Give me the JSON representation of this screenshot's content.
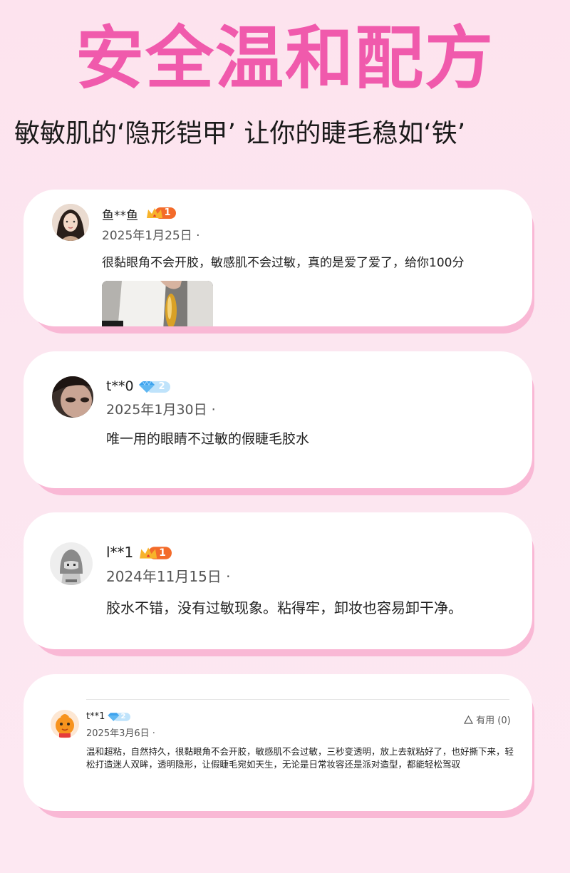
{
  "page": {
    "headline": "安全温和配方",
    "subline": "敏敏肌的‘隐形铠甲’ 让你的睫毛稳如‘铁’"
  },
  "reviews": [
    {
      "username": "鱼**鱼",
      "level": "1",
      "date": "2025年1月25日 ·",
      "comment": "很黏眼角不会开胶，敏感肌不会过敏，真的是爱了爱了，给你100分"
    },
    {
      "username": "t**0",
      "level": "2",
      "date": "2025年1月30日 ·",
      "comment": "唯一用的眼睛不过敏的假睫毛胶水"
    },
    {
      "username": "l**1",
      "level": "1",
      "date": "2024年11月15日 ·",
      "comment": "胶水不错，没有过敏现象。粘得牢，卸妆也容易卸干净。"
    },
    {
      "username": "t**1",
      "level": "2",
      "date": "2025年3月6日 ·",
      "useful_label": "有用 (0)",
      "comment": "温和超粘，自然持久，很黏眼角不会开胶，敏感肌不会过敏，三秒变透明，放上去就粘好了，也好撕下来，轻松打造迷人双眸，透明隐形，让假睫毛宛如天生，无论是日常妆容还是派对造型，都能轻松驾驭"
    }
  ],
  "colors": {
    "headline": "#f05aac",
    "card_shadow": "#f9b8d5",
    "background": "#fde3ee",
    "crown_badge": "#f36b2a",
    "diamond_badge": "#5fb7f2"
  },
  "icons": [
    "crown-badge-icon",
    "diamond-badge-icon",
    "warning-triangle-icon"
  ]
}
